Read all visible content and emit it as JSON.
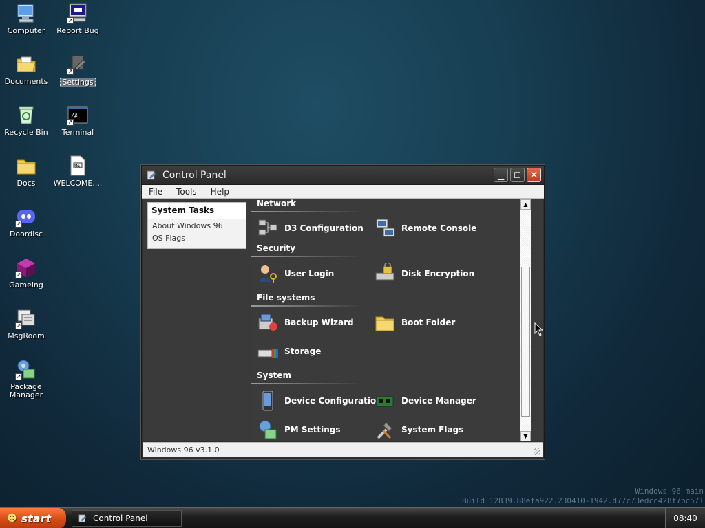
{
  "desktop": {
    "icons": [
      {
        "label": "Computer",
        "icon": "computer-icon",
        "selected": false
      },
      {
        "label": "Report Bug",
        "icon": "report-bug-icon",
        "selected": false
      },
      {
        "label": "Documents",
        "icon": "documents-folder-icon",
        "selected": false
      },
      {
        "label": "Settings",
        "icon": "settings-icon",
        "selected": true
      },
      {
        "label": "Recycle Bin",
        "icon": "recycle-bin-icon",
        "selected": false
      },
      {
        "label": "Terminal",
        "icon": "terminal-icon",
        "selected": false
      },
      {
        "label": "Docs",
        "icon": "folder-icon",
        "selected": false
      },
      {
        "label": "WELCOME....",
        "icon": "markdown-file-icon",
        "selected": false
      },
      {
        "label": "Doordisc",
        "icon": "doordisc-icon",
        "selected": false
      },
      {
        "label": "Gameing",
        "icon": "gameing-icon",
        "selected": false
      },
      {
        "label": "MsgRoom",
        "icon": "msgroom-icon",
        "selected": false
      },
      {
        "label": "Package Manager",
        "icon": "package-manager-icon",
        "selected": false
      }
    ]
  },
  "window": {
    "title": "Control Panel",
    "menu": [
      "File",
      "Tools",
      "Help"
    ],
    "tasks": {
      "heading": "System Tasks",
      "links": [
        "About Windows 96",
        "OS Flags"
      ]
    },
    "sections": [
      {
        "title": "Network",
        "items": [
          {
            "label": "D3 Configuration",
            "icon": "network-config-icon"
          },
          {
            "label": "Remote Console",
            "icon": "remote-console-icon"
          }
        ]
      },
      {
        "title": "Security",
        "items": [
          {
            "label": "User Login",
            "icon": "user-login-icon"
          },
          {
            "label": "Disk Encryption",
            "icon": "disk-encryption-icon"
          }
        ]
      },
      {
        "title": "File systems",
        "items": [
          {
            "label": "Backup Wizard",
            "icon": "backup-wizard-icon"
          },
          {
            "label": "Boot Folder",
            "icon": "boot-folder-icon"
          },
          {
            "label": "Storage",
            "icon": "storage-icon"
          }
        ]
      },
      {
        "title": "System",
        "items": [
          {
            "label": "Device Configuration",
            "icon": "device-config-icon"
          },
          {
            "label": "Device Manager",
            "icon": "device-manager-icon"
          },
          {
            "label": "PM Settings",
            "icon": "pm-settings-icon"
          },
          {
            "label": "System Flags",
            "icon": "system-flags-icon"
          }
        ]
      }
    ],
    "status": "Windows 96 v3.1.0"
  },
  "watermark": {
    "line1": "Windows 96 main",
    "line2": "Build 12839.88efa922.230410-1942.d77c73edcc428f7bc571"
  },
  "taskbar": {
    "start_label": "start",
    "task_item": "Control Panel",
    "clock": "08:40"
  },
  "colors": {
    "start_orange": "#d94e17",
    "close_red": "#c0391e",
    "desktop_bg": "#173e52"
  }
}
